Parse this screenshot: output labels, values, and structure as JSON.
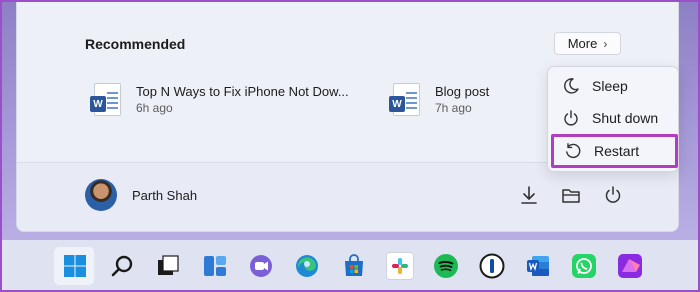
{
  "recommended": {
    "title": "Recommended",
    "more_label": "More",
    "more_chevron": "›",
    "items": [
      {
        "name": "Top N Ways to Fix iPhone Not Dow...",
        "time": "6h ago",
        "icon": "word-document-icon",
        "badge": "W"
      },
      {
        "name": "Blog post",
        "time": "7h ago",
        "icon": "word-document-icon",
        "badge": "W"
      }
    ]
  },
  "power_menu": {
    "items": [
      {
        "label": "Sleep",
        "icon": "moon-icon"
      },
      {
        "label": "Shut down",
        "icon": "power-icon"
      },
      {
        "label": "Restart",
        "icon": "restart-icon",
        "highlighted": true
      }
    ],
    "highlight_color": "#b23dbd"
  },
  "user": {
    "name": "Parth Shah"
  },
  "bottom_bar": {
    "icons": [
      "download-icon",
      "file-explorer-icon",
      "power-icon"
    ]
  },
  "taskbar": {
    "apps": [
      "windows-start-icon",
      "search-icon",
      "task-view-icon",
      "widgets-icon",
      "teams-chat-icon",
      "edge-icon",
      "microsoft-store-icon",
      "slack-icon",
      "spotify-icon",
      "1password-icon",
      "word-icon",
      "whatsapp-icon",
      "affinity-photo-icon"
    ]
  },
  "colors": {
    "word_blue": "#2b579a",
    "accent_purple": "#b23dbd"
  }
}
